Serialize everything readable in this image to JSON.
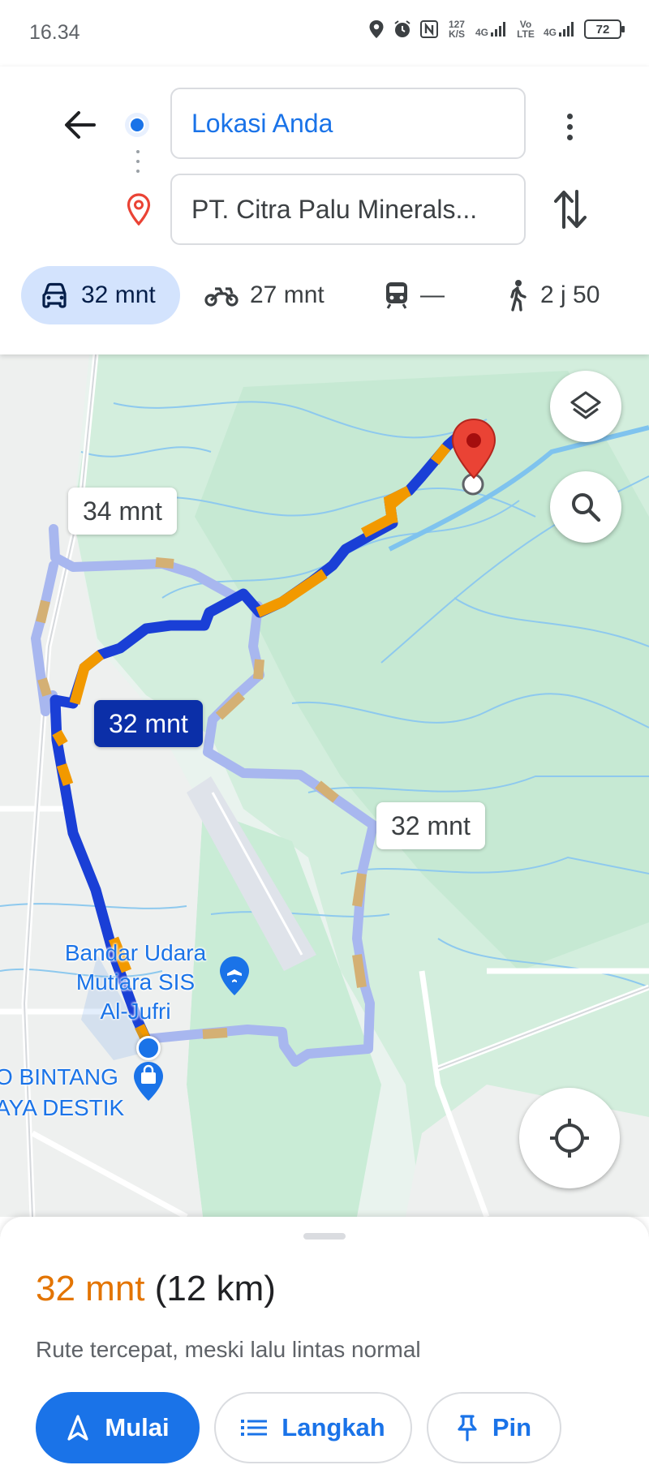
{
  "status_bar": {
    "time": "16.34",
    "net_speed": "127 K/S",
    "signal1": "4G",
    "volte": "Vo LTE",
    "signal2": "4G",
    "battery": "72"
  },
  "search": {
    "origin": "Lokasi Anda",
    "destination": "PT. Citra Palu Minerals..."
  },
  "modes": [
    {
      "icon": "car-icon",
      "label": "32 mnt",
      "active": true
    },
    {
      "icon": "motorcycle-icon",
      "label": "27 mnt"
    },
    {
      "icon": "transit-icon",
      "label": "—"
    },
    {
      "icon": "walk-icon",
      "label": "2 j 50"
    }
  ],
  "map": {
    "route_labels": {
      "selected": "32 mnt",
      "alt_left": "34 mnt",
      "alt_right": "32 mnt"
    },
    "airport_label": "Bandar Udara\nMutiara SIS\nAl-Jufri",
    "poi_label_line1": "O BINTANG",
    "poi_label_line2": "AYA DESTIK",
    "colors": {
      "selected_route": "#1a3fd6",
      "alt_route": "#a8b7ef",
      "traffic_orange": "#f29900",
      "destination_pin": "#ea4335"
    }
  },
  "sheet": {
    "duration": "32 mnt",
    "distance": "(12 km)",
    "description": "Rute tercepat, meski lalu lintas normal",
    "buttons": {
      "start": "Mulai",
      "steps": "Langkah",
      "pin": "Pin"
    }
  }
}
